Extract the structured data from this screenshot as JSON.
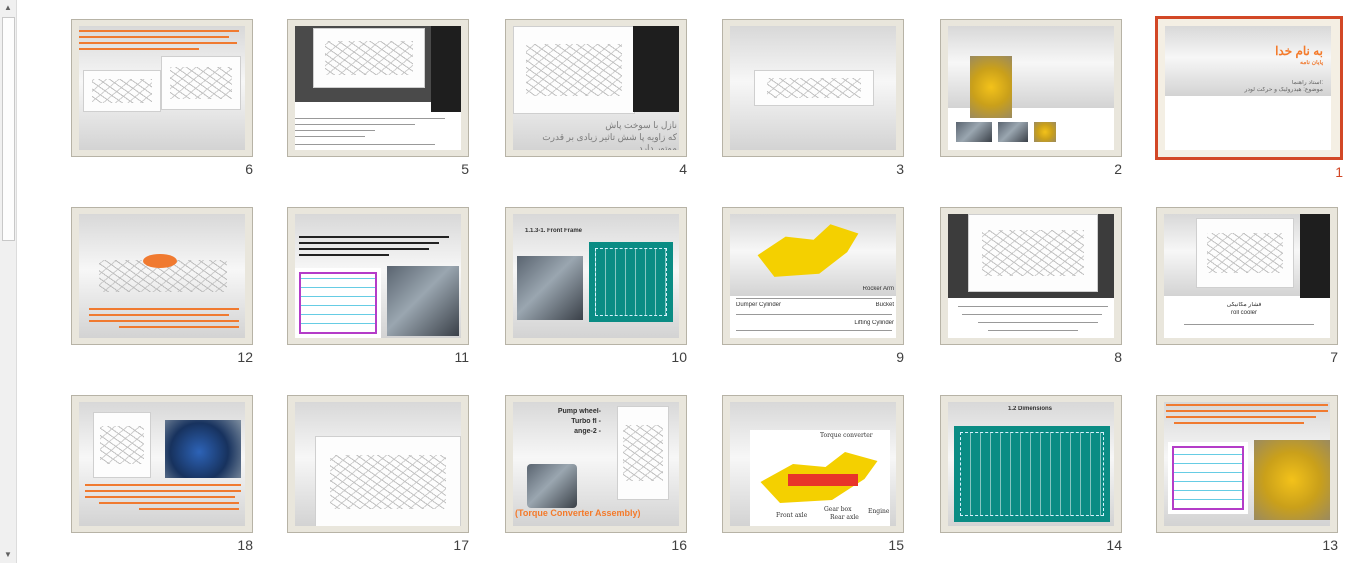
{
  "scrollbar": {
    "up": "▲",
    "down": "▼"
  },
  "colors": {
    "selection": "#d24726",
    "accent_text": "#f47a2a"
  },
  "slides": [
    {
      "number": "1",
      "selected": true,
      "title": "به نام خدا",
      "subtitle": "پایان نامه",
      "lines": [
        "استاد راهنما:",
        "موضوع: هیدرولیک و حرکت لودر"
      ]
    },
    {
      "number": "2"
    },
    {
      "number": "3"
    },
    {
      "number": "4",
      "caption": [
        "نازل با سوخت پاش",
        "که زاویه پا شش تاثیر زیادی بر قدرت موتور دارد"
      ]
    },
    {
      "number": "5"
    },
    {
      "number": "6"
    },
    {
      "number": "7",
      "labels": [
        "فشار مکانیکی",
        "roll cooler"
      ]
    },
    {
      "number": "8"
    },
    {
      "number": "9",
      "labels": [
        "Rocker Arm",
        "Bucket",
        "Dumper Cylinder",
        "Lifting Cylinder"
      ]
    },
    {
      "number": "10",
      "heading": "1.1.3-1. Front Frame"
    },
    {
      "number": "11"
    },
    {
      "number": "12"
    },
    {
      "number": "13"
    },
    {
      "number": "14",
      "heading": "1.2 Dimensions"
    },
    {
      "number": "15",
      "labels": [
        "Torque converter",
        "Front axle",
        "Gear box",
        "Rear axle",
        "Engine"
      ]
    },
    {
      "number": "16",
      "bullets": [
        "Pump wheel-",
        "Turbo fl -",
        "ange-2 -"
      ],
      "caption": "(Torque Converter Assembly)"
    },
    {
      "number": "17"
    },
    {
      "number": "18"
    }
  ]
}
